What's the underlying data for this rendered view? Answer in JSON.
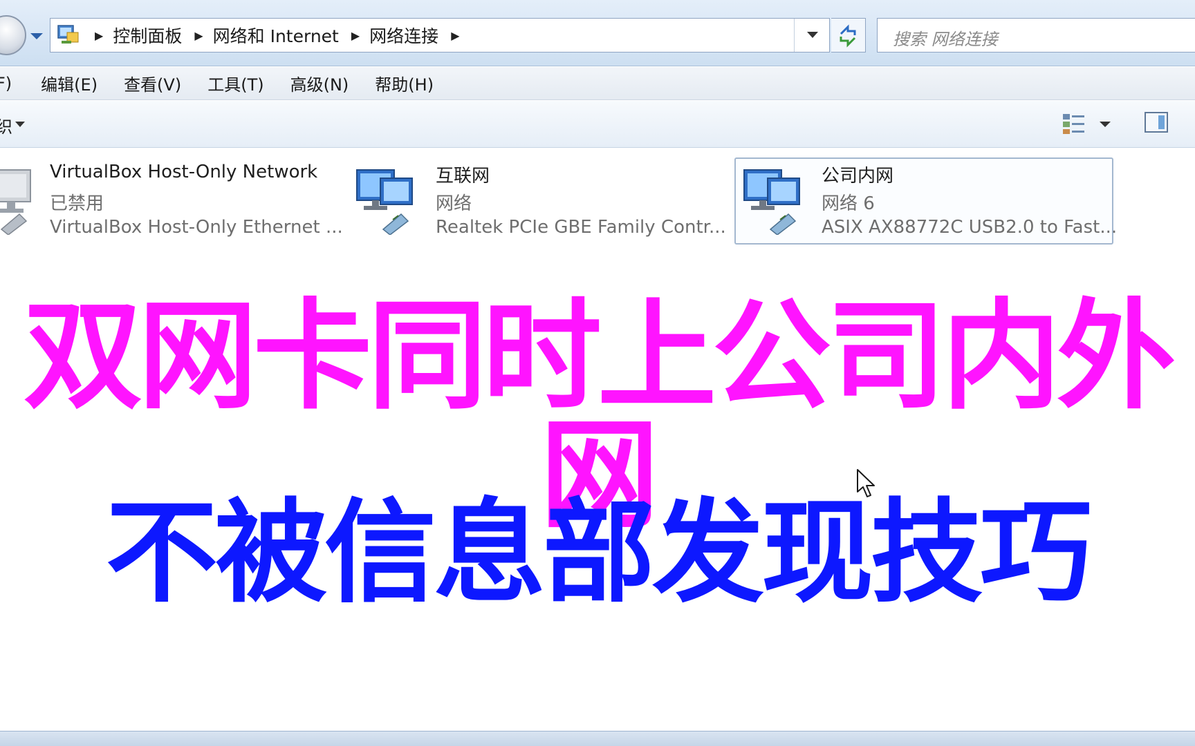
{
  "address": {
    "crumbs": [
      "控制面板",
      "网络和 Internet",
      "网络连接"
    ]
  },
  "search": {
    "placeholder": "搜索 网络连接"
  },
  "menu": {
    "items": [
      "F)",
      "编辑(E)",
      "查看(V)",
      "工具(T)",
      "高级(N)",
      "帮助(H)"
    ]
  },
  "toolbar": {
    "organize_label": "织"
  },
  "connections": [
    {
      "name": "VirtualBox Host-Only Network",
      "status": "已禁用",
      "device": "VirtualBox Host-Only Ethernet ..."
    },
    {
      "name": "互联网",
      "status": "网络",
      "device": "Realtek PCIe GBE Family Contr..."
    },
    {
      "name": "公司内网",
      "status": "网络  6",
      "device": "ASIX AX88772C USB2.0 to Fast..."
    }
  ],
  "captions": {
    "line1": "双网卡同时上公司内外网",
    "line2": "不被信息部发现技巧"
  },
  "colors": {
    "caption1": "#ff14ff",
    "caption2": "#0d18ff",
    "chrome": "#d6e5f5"
  }
}
